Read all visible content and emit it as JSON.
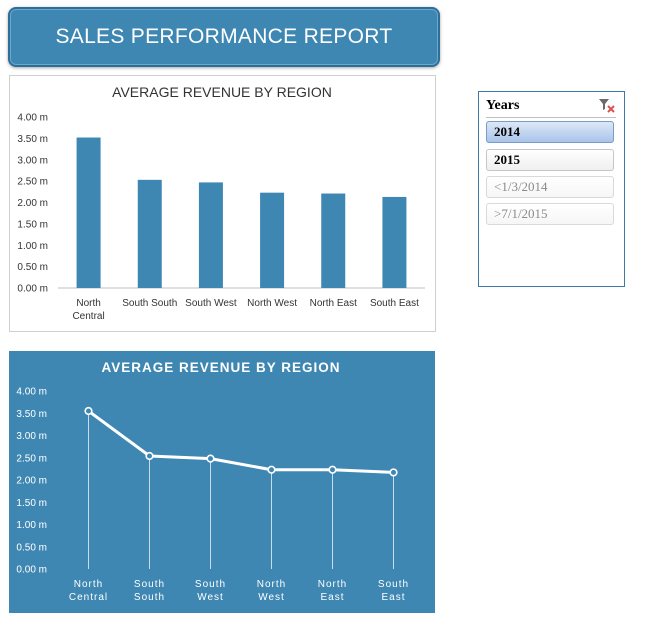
{
  "report": {
    "title": "SALES PERFORMANCE REPORT"
  },
  "slicer": {
    "title": "Years",
    "clear_icon": "clear-filter-icon",
    "items": [
      {
        "label": "2014",
        "state": "selected"
      },
      {
        "label": "2015",
        "state": "normal"
      },
      {
        "label": "<1/3/2014",
        "state": "nodata"
      },
      {
        "label": ">7/1/2015",
        "state": "nodata"
      }
    ]
  },
  "colors": {
    "bar": "#3f87b3",
    "line_bg": "#3f87b3",
    "line": "#ffffff"
  },
  "chart_data": [
    {
      "type": "bar",
      "title": "AVERAGE REVENUE BY REGION",
      "categories": [
        "North Central",
        "South South",
        "South West",
        "North West",
        "North East",
        "South East"
      ],
      "values": [
        3.52,
        2.53,
        2.47,
        2.23,
        2.21,
        2.13
      ],
      "ylim": [
        0,
        4
      ],
      "yticks": [
        "0.00 m",
        "0.50 m",
        "1.00 m",
        "1.50 m",
        "2.00 m",
        "2.50 m",
        "3.00 m",
        "3.50 m",
        "4.00 m"
      ],
      "grid": false,
      "legend": "none"
    },
    {
      "type": "line",
      "title": "AVERAGE REVENUE BY REGION",
      "categories": [
        "North Central",
        "South South",
        "South West",
        "North West",
        "North East",
        "South East"
      ],
      "values": [
        3.55,
        2.54,
        2.48,
        2.23,
        2.23,
        2.17
      ],
      "ylim": [
        0,
        4
      ],
      "yticks": [
        "0.00 m",
        "0.50 m",
        "1.00 m",
        "1.50 m",
        "2.00 m",
        "2.50 m",
        "3.00 m",
        "3.50 m",
        "4.00 m"
      ],
      "grid": false,
      "drop_lines": true,
      "markers": true,
      "legend": "none"
    }
  ]
}
